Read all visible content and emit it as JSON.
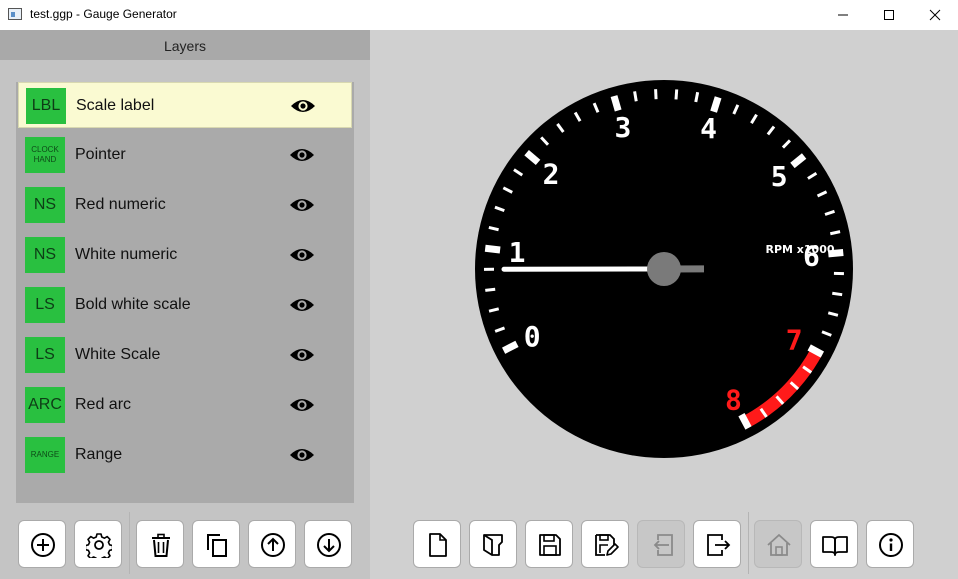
{
  "window": {
    "title": "test.ggp - Gauge Generator"
  },
  "layers_panel": {
    "header": "Layers",
    "items": [
      {
        "badge": "LBL",
        "badge_style": "big",
        "name": "Scale label",
        "selected": true,
        "icon": "eye-icon"
      },
      {
        "badge": "CLOCK HAND",
        "badge_style": "small",
        "name": "Pointer",
        "selected": false,
        "icon": "eye-icon"
      },
      {
        "badge": "NS",
        "badge_style": "big",
        "name": "Red numeric",
        "selected": false,
        "icon": "eye-icon"
      },
      {
        "badge": "NS",
        "badge_style": "big",
        "name": "White numeric",
        "selected": false,
        "icon": "eye-icon"
      },
      {
        "badge": "LS",
        "badge_style": "big",
        "name": "Bold white scale",
        "selected": false,
        "icon": "eye-icon"
      },
      {
        "badge": "LS",
        "badge_style": "big",
        "name": "White Scale",
        "selected": false,
        "icon": "eye-icon"
      },
      {
        "badge": "ARC",
        "badge_style": "big",
        "name": "Red arc",
        "selected": false,
        "icon": "eye-icon"
      },
      {
        "badge": "RANGE",
        "badge_style": "small",
        "name": "Range",
        "selected": false,
        "icon": "eye-icon"
      }
    ]
  },
  "layer_toolbar": [
    "add-layer-icon",
    "layer-settings-icon",
    "delete-icon",
    "duplicate-icon",
    "move-up-icon",
    "move-down-icon"
  ],
  "file_toolbar": [
    {
      "icon": "new-file-icon",
      "enabled": true
    },
    {
      "icon": "open-file-icon",
      "enabled": true
    },
    {
      "icon": "save-icon",
      "enabled": true
    },
    {
      "icon": "save-as-icon",
      "enabled": true
    },
    {
      "icon": "import-icon",
      "enabled": false
    },
    {
      "icon": "export-icon",
      "enabled": true
    },
    {
      "icon": "home-icon",
      "enabled": false
    },
    {
      "icon": "manual-book-icon",
      "enabled": true
    },
    {
      "icon": "info-icon",
      "enabled": true
    }
  ],
  "gauge": {
    "min": 0,
    "max": 8,
    "numbers": [
      "0",
      "1",
      "2",
      "3",
      "4",
      "5",
      "6",
      "7",
      "8"
    ],
    "red_numbers": [
      "7",
      "8"
    ],
    "red_zone_start": 7,
    "label": "RPM x1000",
    "pointer_value": 0.8,
    "colors": {
      "dial": "#000000",
      "numbers": "#ffffff",
      "red": "#ff1a1a",
      "hub": "#7a7a7a"
    }
  }
}
